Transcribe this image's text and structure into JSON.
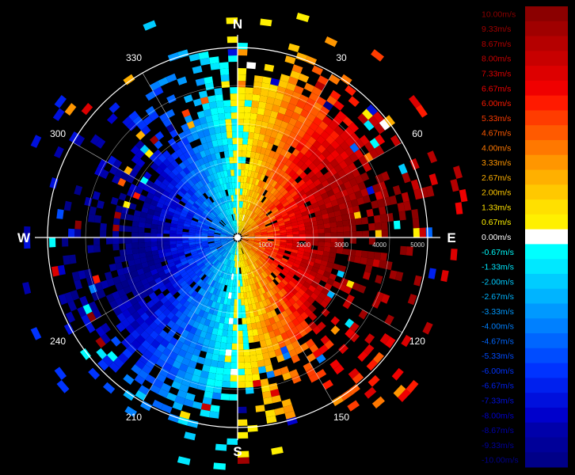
{
  "chart_data": {
    "type": "heatmap",
    "title": "",
    "projection": "polar",
    "quantity_unit": "m/s",
    "cardinal_labels": [
      "N",
      "E",
      "S",
      "W"
    ],
    "azimuth_tick_labels": [
      "30",
      "60",
      "120",
      "150",
      "210",
      "240",
      "300",
      "330"
    ],
    "range_tick_labels": [
      "1000",
      "2000",
      "3000",
      "4000",
      "5000"
    ],
    "range_max": 5000,
    "grid": true,
    "approaching_sector_center_deg": 270,
    "receding_sector_center_deg": 90,
    "max_velocity": 10.0,
    "min_velocity": -10.0,
    "colorbar": {
      "position": "right",
      "labels": [
        "10.00m/s",
        "9.33m/s",
        "8.67m/s",
        "8.00m/s",
        "7.33m/s",
        "6.67m/s",
        "6.00m/s",
        "5.33m/s",
        "4.67m/s",
        "4.00m/s",
        "3.33m/s",
        "2.67m/s",
        "2.00m/s",
        "1.33m/s",
        "0.67m/s",
        "0.00m/s",
        "-0.67m/s",
        "-1.33m/s",
        "-2.00m/s",
        "-2.67m/s",
        "-3.33m/s",
        "-4.00m/s",
        "-4.67m/s",
        "-5.33m/s",
        "-6.00m/s",
        "-6.67m/s",
        "-7.33m/s",
        "-8.00m/s",
        "-8.67m/s",
        "-9.33m/s",
        "-10.00m/s"
      ],
      "colors": [
        "#8b0000",
        "#a00000",
        "#b50000",
        "#c80000",
        "#dd0000",
        "#f00000",
        "#ff1a00",
        "#ff3c00",
        "#ff5a00",
        "#ff7800",
        "#ff9600",
        "#ffb000",
        "#ffc800",
        "#ffe000",
        "#fff000",
        "#ffffff",
        "#00ffff",
        "#00e8ff",
        "#00ccff",
        "#00b4ff",
        "#0099ff",
        "#0080ff",
        "#0066ff",
        "#004cff",
        "#0033ff",
        "#0020ee",
        "#0010dd",
        "#0000cc",
        "#0000aa",
        "#000099",
        "#000088"
      ]
    }
  }
}
